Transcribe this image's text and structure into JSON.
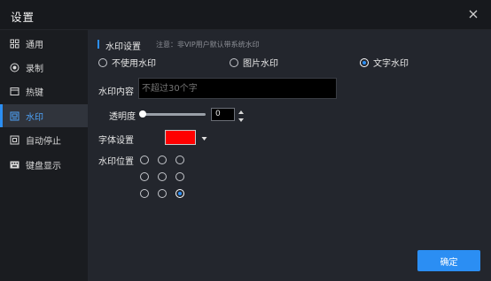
{
  "window": {
    "title": "设置"
  },
  "sidebar": {
    "items": [
      {
        "label": "通用",
        "icon": "grid-icon"
      },
      {
        "label": "录制",
        "icon": "record-icon"
      },
      {
        "label": "热键",
        "icon": "hotkey-icon"
      },
      {
        "label": "水印",
        "icon": "watermark-icon",
        "active": true
      },
      {
        "label": "自动停止",
        "icon": "auto-stop-icon"
      },
      {
        "label": "键盘显示",
        "icon": "keyboard-icon"
      }
    ]
  },
  "watermark": {
    "section_title": "水印设置",
    "note": "注意：非VIP用户默认带系统水印",
    "modes": [
      {
        "label": "不使用水印",
        "selected": false
      },
      {
        "label": "图片水印",
        "selected": false
      },
      {
        "label": "文字水印",
        "selected": true
      }
    ],
    "content_label": "水印内容",
    "content_placeholder": "不超过30个字",
    "content_value": "",
    "opacity_label": "透明度",
    "opacity_value": "0",
    "font_label": "字体设置",
    "font_color": "#ff0000",
    "position_label": "水印位置",
    "position_selected": "bottom-right"
  },
  "footer": {
    "confirm_label": "确定"
  },
  "colors": {
    "accent": "#2b8ef3",
    "background": "#23262d",
    "sidebar": "#1a1c20"
  }
}
